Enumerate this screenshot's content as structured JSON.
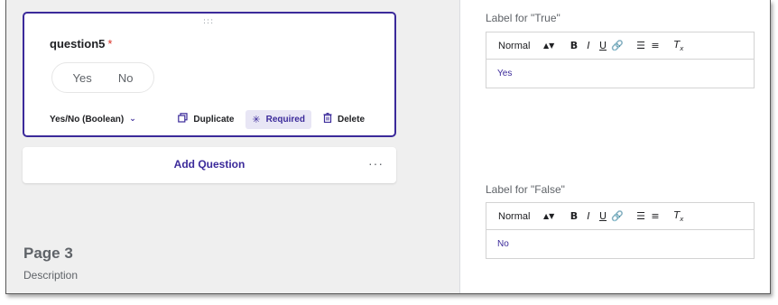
{
  "question": {
    "title": "question5",
    "required_marker": "*",
    "options": [
      "Yes",
      "No"
    ],
    "type_label": "Yes/No (Boolean)",
    "duplicate_label": "Duplicate",
    "required_label": "Required",
    "delete_label": "Delete"
  },
  "add_question_label": "Add Question",
  "page": {
    "title": "Page 3",
    "description": "Description"
  },
  "true_field": {
    "label": "Label for \"True\"",
    "toolbar": {
      "style": "Normal"
    },
    "value": "Yes"
  },
  "false_field": {
    "label": "Label for \"False\"",
    "toolbar": {
      "style": "Normal"
    },
    "value": "No"
  },
  "colors": {
    "accent": "#3b2a9a",
    "required": "#d93025",
    "pane_bg": "#efefef"
  },
  "icons": [
    "drag-handle-icon",
    "chevron-down-icon",
    "duplicate-icon",
    "asterisk-icon",
    "trash-icon",
    "more-horizontal-icon",
    "link-icon",
    "ordered-list-icon",
    "bullet-list-icon",
    "clear-format-icon"
  ]
}
